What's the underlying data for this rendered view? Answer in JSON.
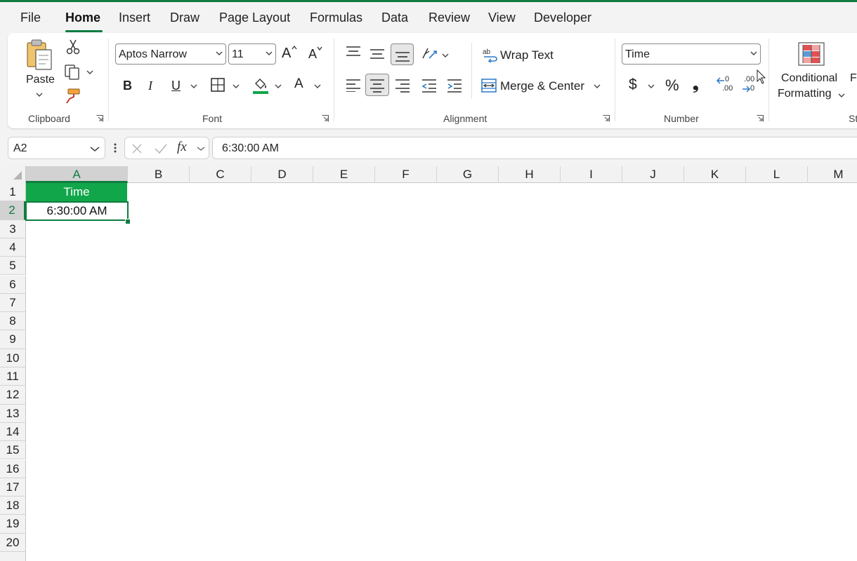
{
  "tabs": [
    "File",
    "Home",
    "Insert",
    "Draw",
    "Page Layout",
    "Formulas",
    "Data",
    "Review",
    "View",
    "Developer"
  ],
  "active_tab": "Home",
  "ribbon": {
    "clipboard": {
      "label": "Clipboard",
      "paste_label": "Paste"
    },
    "font": {
      "label": "Font",
      "font_name": "Aptos Narrow",
      "font_size": "11",
      "grow_label": "A",
      "shrink_label": "A",
      "bold": "B",
      "italic": "I",
      "underline": "U",
      "font_color_letter": "A"
    },
    "alignment": {
      "label": "Alignment",
      "wrap_text": "Wrap Text",
      "merge_center": "Merge & Center"
    },
    "number": {
      "label": "Number",
      "format": "Time",
      "currency": "$",
      "percent": "%",
      "comma": "❟",
      "inc_decimal": ".00",
      "dec_decimal": ".00"
    },
    "styles": {
      "conditional_line1": "Conditional",
      "conditional_line2": "Formatting",
      "cut_off_label": "Fo",
      "cut_off_group": "St"
    }
  },
  "formula_bar": {
    "name_box": "A2",
    "fx_label": "fx",
    "formula": "6:30:00 AM"
  },
  "grid": {
    "columns": [
      "A",
      "B",
      "C",
      "D",
      "E",
      "F",
      "G",
      "H",
      "I",
      "J",
      "K",
      "L",
      "M"
    ],
    "rows": [
      "1",
      "2",
      "3",
      "4",
      "5",
      "6",
      "7",
      "8",
      "9",
      "10",
      "11",
      "12",
      "13",
      "14",
      "15",
      "16",
      "17",
      "18",
      "19",
      "20"
    ],
    "a1": "Time",
    "a2": "6:30:00 AM"
  },
  "colors": {
    "accent": "#107c41",
    "header_fill": "#11a64a"
  }
}
